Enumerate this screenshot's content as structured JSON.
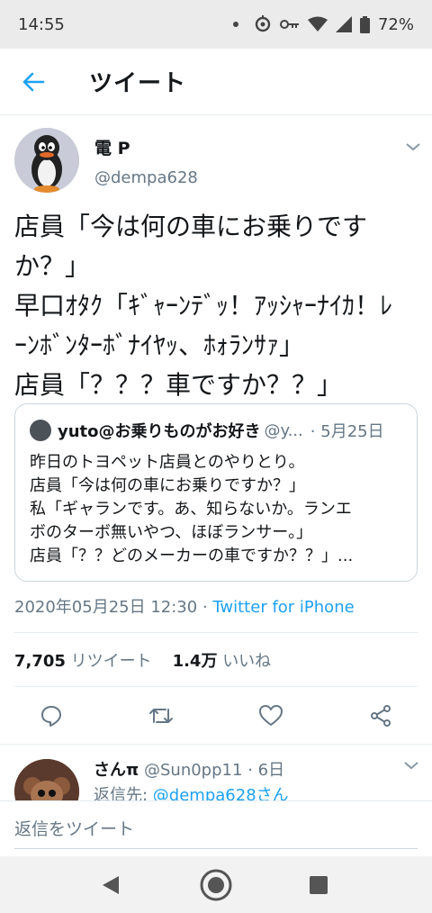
{
  "status_bar": {
    "time": "14:55",
    "battery": "72%"
  },
  "app_bar": {
    "title": "ツイート"
  },
  "tweet": {
    "author_name": "電 P",
    "author_handle": "@dempa628",
    "lines": [
      "店員「今は何の車にお乗りです",
      "か？」",
      "早口ｵﾀｸ「ｷﾞｬｰﾝﾃﾞｯ！ｱｯｼｬｰﾅｲｶ！ﾚ",
      "ｰﾝﾎﾞﾝﾀｰﾎﾞﾅｲﾔｯ、ﾎｫﾗﾝｻｧ」",
      "店員「？？？車ですか？？」"
    ],
    "meta": {
      "datetime": "2020年05月25日 12:30",
      "sep": " · ",
      "source": "Twitter for iPhone"
    },
    "stats": {
      "retweets": "7,705",
      "retweets_label": "リツイート",
      "likes": "1.4万",
      "likes_label": "いいね"
    }
  },
  "quoted_tweet": {
    "name": "yuto@お乗りものがお好き",
    "handle": "@y...",
    "date": "· 5月25日",
    "lines": [
      "昨日のトヨペット店員とのやりとり。",
      "店員「今は何の車にお乗りですか？」",
      "私「ギャランです。あ、知らないか。ランエ",
      "ボのターボ無いやつ、ほぼランサー。」",
      "店員「？？どのメーカーの車ですか？？」..."
    ]
  },
  "reply": {
    "name": "さんπ",
    "handle": "@Sun0pp11",
    "date": "· 6日",
    "reply_to_label": "返信先: ",
    "reply_to_handle": "@dempa628さん"
  },
  "composer": {
    "placeholder": "返信をツイート"
  },
  "colors": {
    "accent": "#1da1f2",
    "secondary_text": "#657786"
  }
}
